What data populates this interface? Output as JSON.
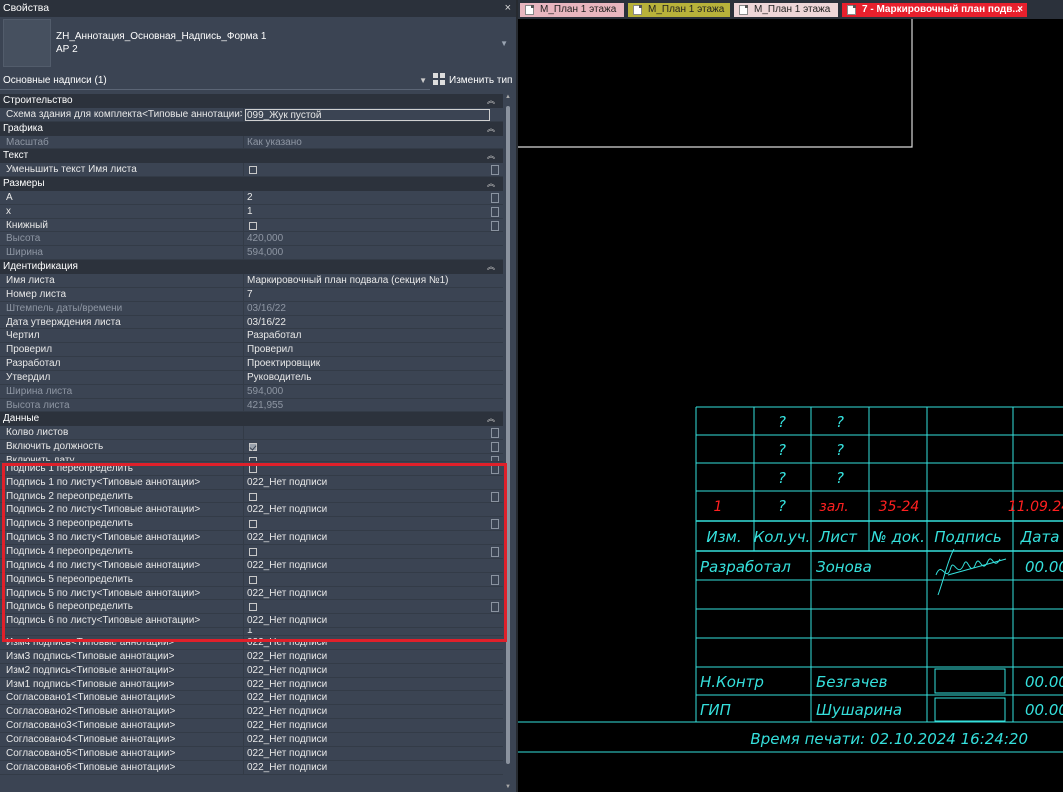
{
  "panel": {
    "title": "Свойства",
    "close_glyph": "×",
    "type_name_line1": "ZH_Аннотация_Основная_Надпись_Форма 1",
    "type_name_line2": "АР 2",
    "filter": "Основные надписи (1)",
    "edit_type": "Изменить тип"
  },
  "groups": {
    "construction": "Строительство",
    "graphics": "Графика",
    "text": "Текст",
    "dimensions": "Размеры",
    "identity": "Идентификация",
    "data": "Данные"
  },
  "rows": {
    "scheme": {
      "label": "Схема здания для комплекта<Типовые аннотации>",
      "value": "099_Жук пустой"
    },
    "scale": {
      "label": "Масштаб",
      "value": "Как указано"
    },
    "shrink": {
      "label": "Уменьшить текст Имя листа"
    },
    "a": {
      "label": "А",
      "value": "2"
    },
    "x": {
      "label": "х",
      "value": "1"
    },
    "book": {
      "label": "Книжный"
    },
    "height": {
      "label": "Высота",
      "value": "420,000"
    },
    "width": {
      "label": "Ширина",
      "value": "594,000"
    },
    "sheet_name": {
      "label": "Имя листа",
      "value": "Маркировочный план подвала (секция №1)"
    },
    "sheet_number": {
      "label": "Номер листа",
      "value": "7"
    },
    "stamp": {
      "label": "Штемпель даты/времени",
      "value": "03/16/22"
    },
    "approve_date": {
      "label": "Дата утверждения листа",
      "value": "03/16/22"
    },
    "drawn": {
      "label": "Чертил",
      "value": "Разработал"
    },
    "checked": {
      "label": "Проверил",
      "value": "Проверил"
    },
    "designed": {
      "label": "Разработал",
      "value": "Проектировщик"
    },
    "approved": {
      "label": "Утвердил",
      "value": "Руководитель"
    },
    "sheet_width": {
      "label": "Ширина листа",
      "value": "594,000"
    },
    "sheet_height": {
      "label": "Высота листа",
      "value": "421,955"
    },
    "sheets_count": {
      "label": "Колво листов"
    },
    "include_position": {
      "label": "Включить должность"
    },
    "include_date": {
      "label": "Включить дату"
    },
    "sig1_override": {
      "label": "Подпись 1 переопределить"
    },
    "sig1_sheet": {
      "label": "Подпись 1 по листу<Типовые аннотации>",
      "value": "022_Нет подписи"
    },
    "sig2_override": {
      "label": "Подпись 2 переопределить"
    },
    "sig2_sheet": {
      "label": "Подпись 2 по листу<Типовые аннотации>",
      "value": "022_Нет подписи"
    },
    "sig3_override": {
      "label": "Подпись 3 переопределить"
    },
    "sig3_sheet": {
      "label": "Подпись 3 по листу<Типовые аннотации>",
      "value": "022_Нет подписи"
    },
    "sig4_override": {
      "label": "Подпись 4 переопределить"
    },
    "sig4_sheet": {
      "label": "Подпись 4 по листу<Типовые аннотации>",
      "value": "022_Нет подписи"
    },
    "sig5_override": {
      "label": "Подпись 5 переопределить"
    },
    "sig5_sheet": {
      "label": "Подпись 5 по листу<Типовые аннотации>",
      "value": "022_Нет подписи"
    },
    "sig6_override": {
      "label": "Подпись 6 переопределить"
    },
    "sig6_sheet": {
      "label": "Подпись 6 по листу<Типовые аннотации>",
      "value": "022_Нет подписи"
    },
    "hidden_row": {
      "label": "",
      "value": "1"
    },
    "izm4": {
      "label": "Изм4 подпись<Типовые аннотации>",
      "value": "022_Нет подписи"
    },
    "izm3": {
      "label": "Изм3 подпись<Типовые аннотации>",
      "value": "022_Нет подписи"
    },
    "izm2": {
      "label": "Изм2 подпись<Типовые аннотации>",
      "value": "022_Нет подписи"
    },
    "izm1": {
      "label": "Изм1 подпись<Типовые аннотации>",
      "value": "022_Нет подписи"
    },
    "agreed1": {
      "label": "Согласовано1<Типовые аннотации>",
      "value": "022_Нет подписи"
    },
    "agreed2": {
      "label": "Согласовано2<Типовые аннотации>",
      "value": "022_Нет подписи"
    },
    "agreed3": {
      "label": "Согласовано3<Типовые аннотации>",
      "value": "022_Нет подписи"
    },
    "agreed4": {
      "label": "Согласовано4<Типовые аннотации>",
      "value": "022_Нет подписи"
    },
    "agreed5": {
      "label": "Согласовано5<Типовые аннотации>",
      "value": "022_Нет подписи"
    },
    "agreed6": {
      "label": "Согласовано6<Типовые аннотации>",
      "value": "022_Нет подписи"
    }
  },
  "checkboxes": {
    "include_position": true
  },
  "tabs": [
    {
      "label": "М_План 1 этажа"
    },
    {
      "label": "М_План 1 этажа"
    },
    {
      "label": "М_План 1 этажа"
    },
    {
      "label": "7 - Маркировочный план подв..."
    }
  ],
  "colors": {
    "accent_red": "#e0202a",
    "cad_cyan": "#35e0dc",
    "cad_red": "#ff2020",
    "panel_bg": "#3b4453"
  },
  "title_block": {
    "q": "?",
    "change_num": "1",
    "change_qty": "?",
    "change_note": "зал.",
    "change_doc": "35-24",
    "change_date": "11.09.24",
    "h_izm": "Изм.",
    "h_kol": "Кол.уч.",
    "h_list": "Лист",
    "h_doc": "№ док.",
    "h_sign": "Подпись",
    "h_date": "Дата",
    "r1_role": "Разработал",
    "r1_name": "Зонова",
    "r1_date": "00.00",
    "r2_role": "Н.Контр",
    "r2_name": "Безгачев",
    "r2_date": "00.00",
    "r3_role": "ГИП",
    "r3_name": "Шушарина",
    "r3_date": "00.00",
    "print_time": "Время печати: 02.10.2024 16:24:20"
  }
}
